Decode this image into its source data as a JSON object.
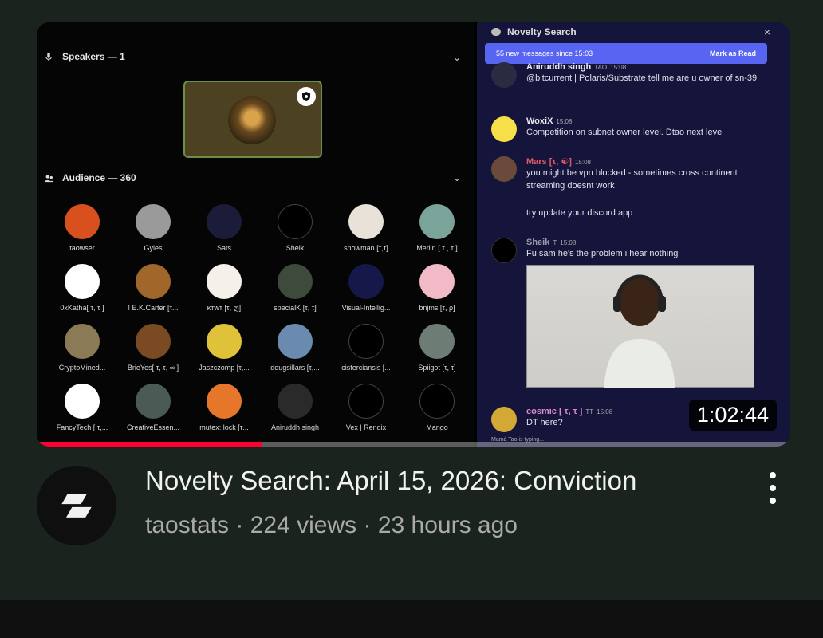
{
  "video": {
    "title": "Novelty Search: April 15, 2026: Conviction",
    "channel": "taostats",
    "views": "224 views",
    "age": "23 hours ago",
    "separator": "·",
    "duration": "1:02:44",
    "progress_fraction": 0.3
  },
  "thumbnail": {
    "speakers_heading": "Speakers — 1",
    "audience_heading": "Audience — 360",
    "audience": [
      {
        "name": "taowser",
        "color": "#d9501f"
      },
      {
        "name": "Gyles",
        "color": "#9a9a9a"
      },
      {
        "name": "Sats",
        "color": "#1a1c3a"
      },
      {
        "name": "Sheik",
        "color": "#000000"
      },
      {
        "name": "snowman [τ,τ]",
        "color": "#e8e2d8"
      },
      {
        "name": "Merlin [ τ , τ ]",
        "color": "#7aa39a"
      },
      {
        "name": "0xKatha[ τ, τ ]",
        "color": "#ffffff"
      },
      {
        "name": "! E.K.Carter [τ...",
        "color": "#a0662a"
      },
      {
        "name": "ĸтwт [τ, ღ]",
        "color": "#f3f1e9"
      },
      {
        "name": "specialK [τ, τ]",
        "color": "#3d4a3c"
      },
      {
        "name": "Visual-Intellig...",
        "color": "#16184a"
      },
      {
        "name": "bnjms [τ, ρ]",
        "color": "#f2b9c6"
      },
      {
        "name": "CryptoMined...",
        "color": "#8a7a55"
      },
      {
        "name": "BrieYes[ τ, τ, ∞ ]",
        "color": "#7a4a22"
      },
      {
        "name": "Jaszczomp [τ,...",
        "color": "#e0c23a"
      },
      {
        "name": "dougsillars [τ,...",
        "color": "#6a8ab0"
      },
      {
        "name": "cisterciansis [...",
        "color": "#000000"
      },
      {
        "name": "Spiigot [τ, τ]",
        "color": "#6d7c74"
      },
      {
        "name": "FancyTech [ τ,...",
        "color": "#ffffff"
      },
      {
        "name": "CreativeEssen...",
        "color": "#4a5a55"
      },
      {
        "name": "mutex::lock [τ...",
        "color": "#e6772a"
      },
      {
        "name": "Aniruddh singh",
        "color": "#2a2a2a"
      },
      {
        "name": "Vex | Rendix",
        "color": "#000000"
      },
      {
        "name": "Mango",
        "color": "#000000"
      }
    ],
    "chat": {
      "title": "Novelty Search",
      "close": "×",
      "new_messages": "55 new messages since 15:03",
      "mark_read": "Mark as Read",
      "messages": [
        {
          "author": "Aniruddh singh",
          "tag": "TAO",
          "time": "15:08",
          "text": "@bitcurrent | Polaris/Substrate  tell me are u owner of sn-39",
          "color": "#c8c8d8"
        },
        {
          "author": "WoxiX",
          "tag": "",
          "time": "15:08",
          "text": "Competition on subnet owner level. Dtao next level",
          "color": "#e8e8f0"
        },
        {
          "author": "Mars [τ, ☯]",
          "tag": "",
          "time": "15:08",
          "text": "you might be vpn blocked - sometimes cross continent streaming doesnt work",
          "text2": "try update your discord app",
          "color": "#e05a6a"
        },
        {
          "author": "Sheik",
          "tag": "T",
          "time": "15:08",
          "text": "Fu sam he's the problem i hear nothing",
          "color": "#9a9ab0"
        },
        {
          "author": "cosmic [ τ, τ ]",
          "tag": "TT",
          "time": "15:08",
          "text": "DT here?",
          "color": "#d78bc8"
        }
      ],
      "typing": "Mamá Tao is typing..."
    },
    "accent_colors": {
      "progress": "#ff0033",
      "discord_blurple": "#5865f2"
    }
  }
}
